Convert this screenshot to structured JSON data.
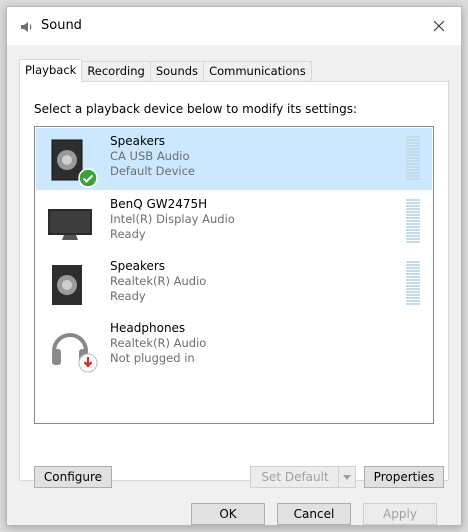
{
  "window": {
    "title": "Sound",
    "icon": "speaker-icon"
  },
  "tabs": [
    {
      "label": "Playback",
      "active": true
    },
    {
      "label": "Recording",
      "active": false
    },
    {
      "label": "Sounds",
      "active": false
    },
    {
      "label": "Communications",
      "active": false
    }
  ],
  "playback": {
    "instruction": "Select a playback device below to modify its settings:",
    "devices": [
      {
        "name": "Speakers",
        "driver": "CA USB Audio",
        "status": "Default Device",
        "icon": "speaker-icon",
        "badge": "default-check",
        "selected": true
      },
      {
        "name": "BenQ GW2475H",
        "driver": "Intel(R) Display Audio",
        "status": "Ready",
        "icon": "monitor-icon",
        "selected": false
      },
      {
        "name": "Speakers",
        "driver": "Realtek(R) Audio",
        "status": "Ready",
        "icon": "speaker-icon",
        "selected": false
      },
      {
        "name": "Headphones",
        "driver": "Realtek(R) Audio",
        "status": "Not plugged in",
        "icon": "headphones-icon",
        "badge": "unplugged-arrow",
        "selected": false
      }
    ],
    "buttons": {
      "configure": "Configure",
      "set_default": "Set Default",
      "properties": "Properties"
    }
  },
  "footer": {
    "ok": "OK",
    "cancel": "Cancel",
    "apply": "Apply"
  },
  "colors": {
    "selection": "#cce8ff",
    "check_green": "#3aa43a",
    "unplugged_red": "#d62b2b"
  }
}
